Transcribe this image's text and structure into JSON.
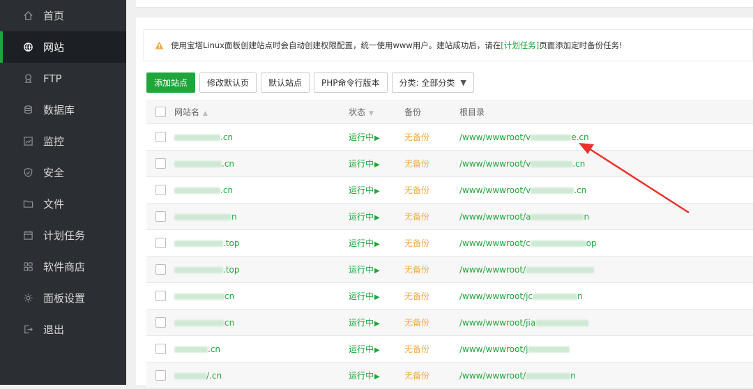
{
  "sidebar": {
    "items": [
      {
        "label": "首页",
        "icon": "home-icon",
        "active": false
      },
      {
        "label": "网站",
        "icon": "globe-icon",
        "active": true
      },
      {
        "label": "FTP",
        "icon": "ftp-icon",
        "active": false
      },
      {
        "label": "数据库",
        "icon": "database-icon",
        "active": false
      },
      {
        "label": "监控",
        "icon": "monitor-icon",
        "active": false
      },
      {
        "label": "安全",
        "icon": "shield-icon",
        "active": false
      },
      {
        "label": "文件",
        "icon": "folder-icon",
        "active": false
      },
      {
        "label": "计划任务",
        "icon": "calendar-icon",
        "active": false
      },
      {
        "label": "软件商店",
        "icon": "grid-icon",
        "active": false
      },
      {
        "label": "面板设置",
        "icon": "gear-icon",
        "active": false
      },
      {
        "label": "退出",
        "icon": "logout-icon",
        "active": false
      }
    ]
  },
  "notice": {
    "text_before": "使用宝塔Linux面板创建站点时会自动创建权限配置，统一使用www用户。建站成功后，请在",
    "link": "[计划任务]",
    "text_after": "页面添加定时备份任务!"
  },
  "toolbar": {
    "add_site": "添加站点",
    "edit_default_page": "修改默认页",
    "default_site": "默认站点",
    "php_cli_version": "PHP命令行版本",
    "category": "分类: 全部分类"
  },
  "table": {
    "headers": {
      "name": "网站名",
      "status": "状态",
      "backup": "备份",
      "root": "根目录"
    },
    "rows": [
      {
        "name_suffix": ".cn",
        "status": "运行中",
        "backup": "无备份",
        "root_prefix": "/www/wwwroot/v",
        "root_suffix": "e.cn"
      },
      {
        "name_suffix": ".cn",
        "status": "运行中",
        "backup": "无备份",
        "root_prefix": "/www/wwwroot/v",
        "root_suffix": ".cn"
      },
      {
        "name_suffix": ".cn",
        "status": "运行中",
        "backup": "无备份",
        "root_prefix": "/www/wwwroot/v",
        "root_suffix": ".cn"
      },
      {
        "name_suffix": "n",
        "status": "运行中",
        "backup": "无备份",
        "root_prefix": "/www/wwwroot/a",
        "root_suffix": "n"
      },
      {
        "name_suffix": ".top",
        "status": "运行中",
        "backup": "无备份",
        "root_prefix": "/www/wwwroot/c",
        "root_suffix": "op"
      },
      {
        "name_suffix": ".top",
        "status": "运行中",
        "backup": "无备份",
        "root_prefix": "/www/wwwroot/",
        "root_suffix": ""
      },
      {
        "name_suffix": "cn",
        "status": "运行中",
        "backup": "无备份",
        "root_prefix": "/www/wwwroot/jc",
        "root_suffix": "n"
      },
      {
        "name_suffix": "cn",
        "status": "运行中",
        "backup": "无备份",
        "root_prefix": "/www/wwwroot/jia",
        "root_suffix": ""
      },
      {
        "name_suffix": ".cn",
        "status": "运行中",
        "backup": "无备份",
        "root_prefix": "/www/wwwroot/j",
        "root_suffix": ""
      },
      {
        "name_suffix": "/.cn",
        "status": "运行中",
        "backup": "无备份",
        "root_prefix": "/www/wwwroot/",
        "root_suffix": "n"
      }
    ]
  },
  "colors": {
    "accent": "#20a53a",
    "backup_warning": "#f0ad4e",
    "annotation_arrow": "#e8322b",
    "sidebar_bg": "#2b2f33"
  }
}
